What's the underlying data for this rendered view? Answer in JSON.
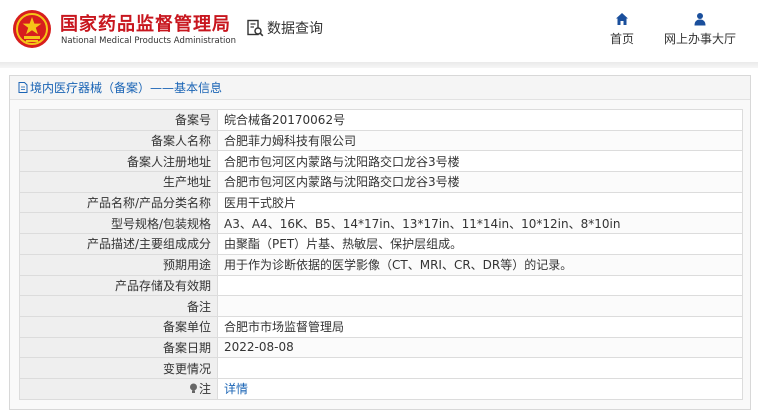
{
  "header": {
    "brand_cn": "国家药品监督管理局",
    "brand_en": "National Medical Products Administration",
    "query_label": "数据查询",
    "nav": [
      {
        "label": "首页",
        "icon": "home-icon"
      },
      {
        "label": "网上办事大厅",
        "icon": "user-icon"
      }
    ]
  },
  "panel": {
    "title": "境内医疗器械（备案）——基本信息",
    "rows": [
      {
        "key": "备案号",
        "value": "皖合械备20170062号"
      },
      {
        "key": "备案人名称",
        "value": "合肥菲力姆科技有限公司"
      },
      {
        "key": "备案人注册地址",
        "value": "合肥市包河区内蒙路与沈阳路交口龙谷3号楼"
      },
      {
        "key": "生产地址",
        "value": "合肥市包河区内蒙路与沈阳路交口龙谷3号楼"
      },
      {
        "key": "产品名称/产品分类名称",
        "value": "医用干式胶片"
      },
      {
        "key": "型号规格/包装规格",
        "value": "A3、A4、16K、B5、14*17in、13*17in、11*14in、10*12in、8*10in"
      },
      {
        "key": "产品描述/主要组成成分",
        "value": "由聚酯（PET）片基、热敏层、保护层组成。"
      },
      {
        "key": "预期用途",
        "value": "用于作为诊断依据的医学影像（CT、MRI、CR、DR等）的记录。"
      },
      {
        "key": "产品存储及有效期",
        "value": ""
      },
      {
        "key": "备注",
        "value": ""
      },
      {
        "key": "备案单位",
        "value": "合肥市市场监督管理局"
      },
      {
        "key": "备案日期",
        "value": "2022-08-08"
      },
      {
        "key": "变更情况",
        "value": ""
      }
    ],
    "note_row": {
      "key": "注",
      "value": "详情",
      "icon": "lightbulb-icon"
    }
  },
  "colors": {
    "brand_red": "#c8161e",
    "link_blue": "#1a64b5",
    "nav_blue": "#1a4f9c"
  }
}
